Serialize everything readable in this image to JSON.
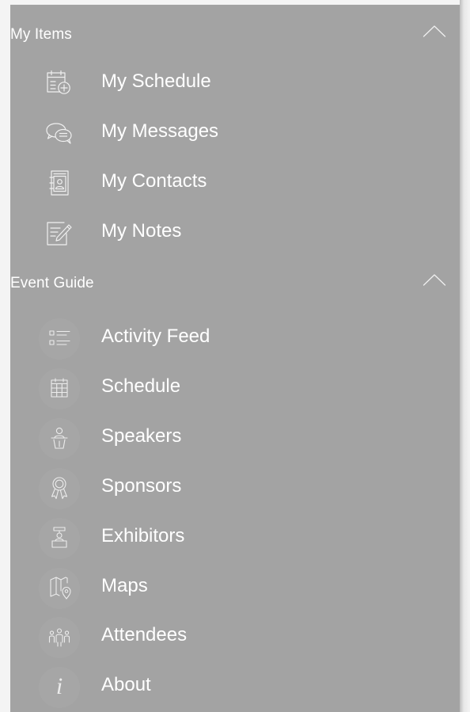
{
  "my_items": {
    "title": "My Items",
    "items": [
      {
        "label": "My Schedule",
        "icon": "schedule-add-icon"
      },
      {
        "label": "My Messages",
        "icon": "messages-icon"
      },
      {
        "label": "My Contacts",
        "icon": "contacts-icon"
      },
      {
        "label": "My Notes",
        "icon": "notes-icon"
      }
    ]
  },
  "event_guide": {
    "title": "Event Guide",
    "items": [
      {
        "label": "Activity Feed",
        "icon": "activity-feed-icon"
      },
      {
        "label": "Schedule",
        "icon": "calendar-icon"
      },
      {
        "label": "Speakers",
        "icon": "speaker-podium-icon"
      },
      {
        "label": "Sponsors",
        "icon": "award-ribbon-icon"
      },
      {
        "label": "Exhibitors",
        "icon": "exhibitor-booth-icon"
      },
      {
        "label": "Maps",
        "icon": "map-pin-icon"
      },
      {
        "label": "Attendees",
        "icon": "attendees-icon"
      },
      {
        "label": "About",
        "icon": "info-icon",
        "glyph": "i"
      }
    ]
  },
  "colors": {
    "drawer_background": "#a3a3a3",
    "text": "#ffffff",
    "icon_stroke": "#f0f0f0",
    "page_background": "#f2f2f2"
  }
}
